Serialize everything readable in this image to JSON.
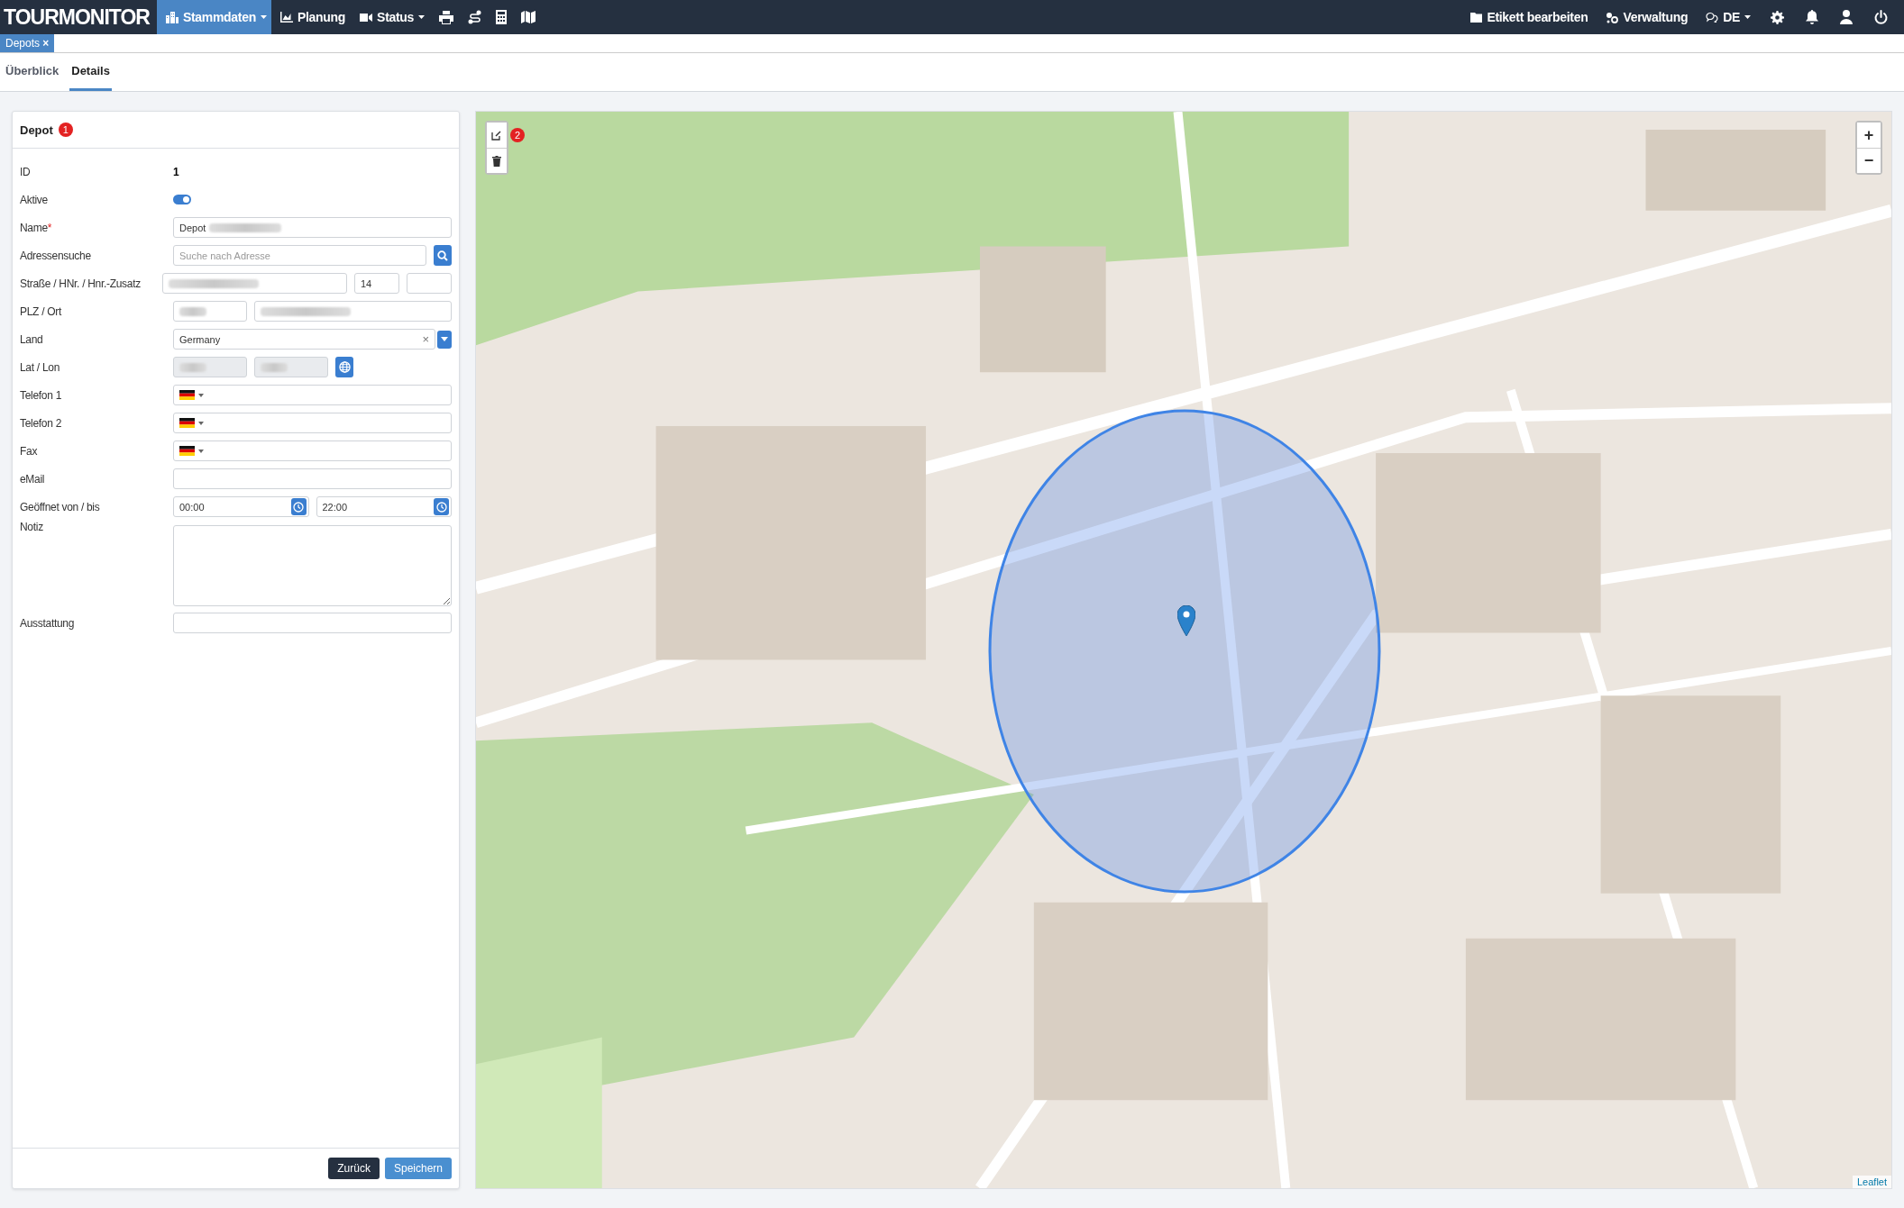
{
  "app": {
    "logo": "TOURMONITOR"
  },
  "nav": [
    {
      "label": "Stammdaten",
      "selected": true,
      "dropdown": true
    },
    {
      "label": "Planung",
      "selected": false,
      "dropdown": false
    },
    {
      "label": "Status",
      "selected": false,
      "dropdown": true
    }
  ],
  "nav_right": [
    {
      "label": "Etikett bearbeiten",
      "dropdown": false
    },
    {
      "label": "Verwaltung",
      "dropdown": false
    },
    {
      "label": "DE",
      "dropdown": true
    }
  ],
  "open_tabs": [
    {
      "label": "Depots",
      "close": "×"
    }
  ],
  "subtabs": [
    {
      "label": "Überblick",
      "selected": false
    },
    {
      "label": "Details",
      "selected": true
    }
  ],
  "panel": {
    "title": "Depot",
    "badge": "1"
  },
  "fields": [
    {
      "kind": "static",
      "label": "ID",
      "value": "1"
    },
    {
      "kind": "toggle",
      "label": "Aktive",
      "on": true
    },
    {
      "kind": "name",
      "label": "Name",
      "required_mark": "*",
      "value": "Depot"
    },
    {
      "kind": "search",
      "label": "Adressensuche",
      "placeholder": "Suche nach Adresse"
    },
    {
      "kind": "street",
      "label": "Straße / HNr. / Hnr.-Zusatz",
      "house_number": "14"
    },
    {
      "kind": "city",
      "label": "PLZ / Ort"
    },
    {
      "kind": "select",
      "label": "Land",
      "value": "Germany",
      "clear": "×"
    },
    {
      "kind": "latlon",
      "label": "Lat / Lon"
    },
    {
      "kind": "phone",
      "label": "Telefon 1"
    },
    {
      "kind": "phone",
      "label": "Telefon 2"
    },
    {
      "kind": "phone",
      "label": "Fax"
    },
    {
      "kind": "input",
      "label": "eMail"
    },
    {
      "kind": "time",
      "label": "Geöffnet von / bis",
      "from": "00:00",
      "to": "22:00"
    },
    {
      "kind": "textarea",
      "label": "Notiz"
    },
    {
      "kind": "input",
      "label": "Ausstattung"
    }
  ],
  "buttons": [
    {
      "label": "Zurück",
      "kind": "dark"
    },
    {
      "label": "Speichern",
      "kind": "primary"
    }
  ],
  "map": {
    "badge": "2",
    "zoom_in": "+",
    "zoom_out": "−",
    "attribution": "Leaflet",
    "radius_shown": true
  }
}
